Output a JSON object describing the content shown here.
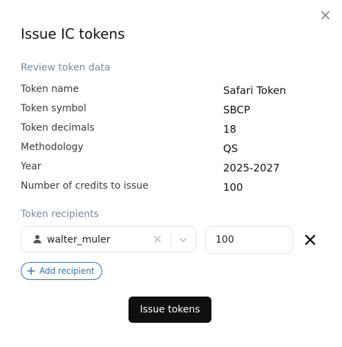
{
  "modal": {
    "title": "Issue IC tokens",
    "close_icon": "close-icon"
  },
  "review": {
    "section_label": "Review token data",
    "rows": [
      {
        "label": "Token name",
        "value": "Safari Token"
      },
      {
        "label": "Token symbol",
        "value": "SBCP"
      },
      {
        "label": "Token decimals",
        "value": "18"
      },
      {
        "label": "Methodology",
        "value": "QS"
      },
      {
        "label": "Year",
        "value": "2025-2027"
      },
      {
        "label": "Number of credits to issue",
        "value": "100"
      }
    ]
  },
  "recipients": {
    "section_label": "Token recipients",
    "items": [
      {
        "user": "walter_muler",
        "amount": "100",
        "user_icon": "user-icon"
      }
    ],
    "add_label": "Add recipient"
  },
  "actions": {
    "issue_label": "Issue tokens"
  },
  "colors": {
    "accent": "#2d6fb5",
    "primary_button": "#0f0f0f",
    "muted_label": "#7a8aa0"
  }
}
